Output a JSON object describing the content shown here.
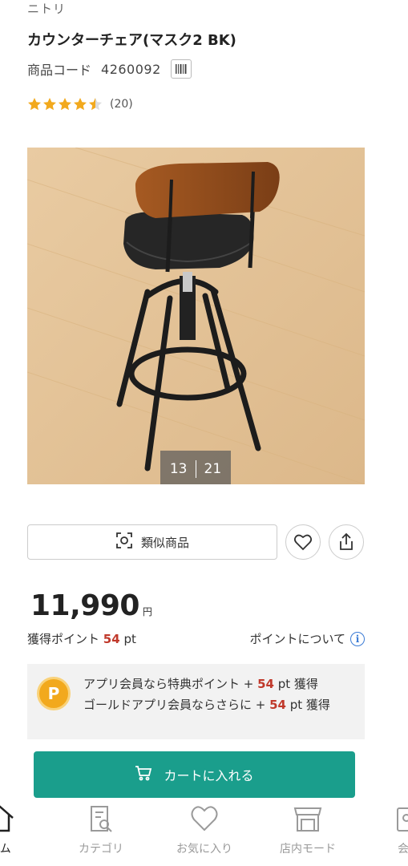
{
  "product": {
    "brand": "ニトリ",
    "title": "カウンターチェア(マスク2 BK)",
    "code_label": "商品コード",
    "code": "4260092",
    "rating": 4.5,
    "review_count": "(20)"
  },
  "gallery": {
    "current": "13",
    "total": "21"
  },
  "actions": {
    "similar_label": "類似商品"
  },
  "price": {
    "amount": "11,990",
    "unit": "円"
  },
  "points": {
    "earned_label": "獲得ポイント",
    "earned_value": "54",
    "earned_unit": "pt",
    "about_label": "ポイントについて"
  },
  "bonus": {
    "coin_letter": "P",
    "line1_prefix": "アプリ会員なら特典ポイント + ",
    "line1_value": "54",
    "line1_suffix": " pt 獲得",
    "line2_prefix": "ゴールドアプリ会員ならさらに + ",
    "line2_value": "54",
    "line2_suffix": " pt 獲得"
  },
  "cart": {
    "label": "カートに入れる",
    "color": "#1a9e8c"
  },
  "nav": {
    "home": "ーム",
    "category": "カテゴリ",
    "favorites": "お気に入り",
    "store_mode": "店内モード",
    "member": "会員"
  },
  "colors": {
    "accent_red": "#c0392b",
    "star": "#f2a91d",
    "info_blue": "#3a7bd5"
  }
}
